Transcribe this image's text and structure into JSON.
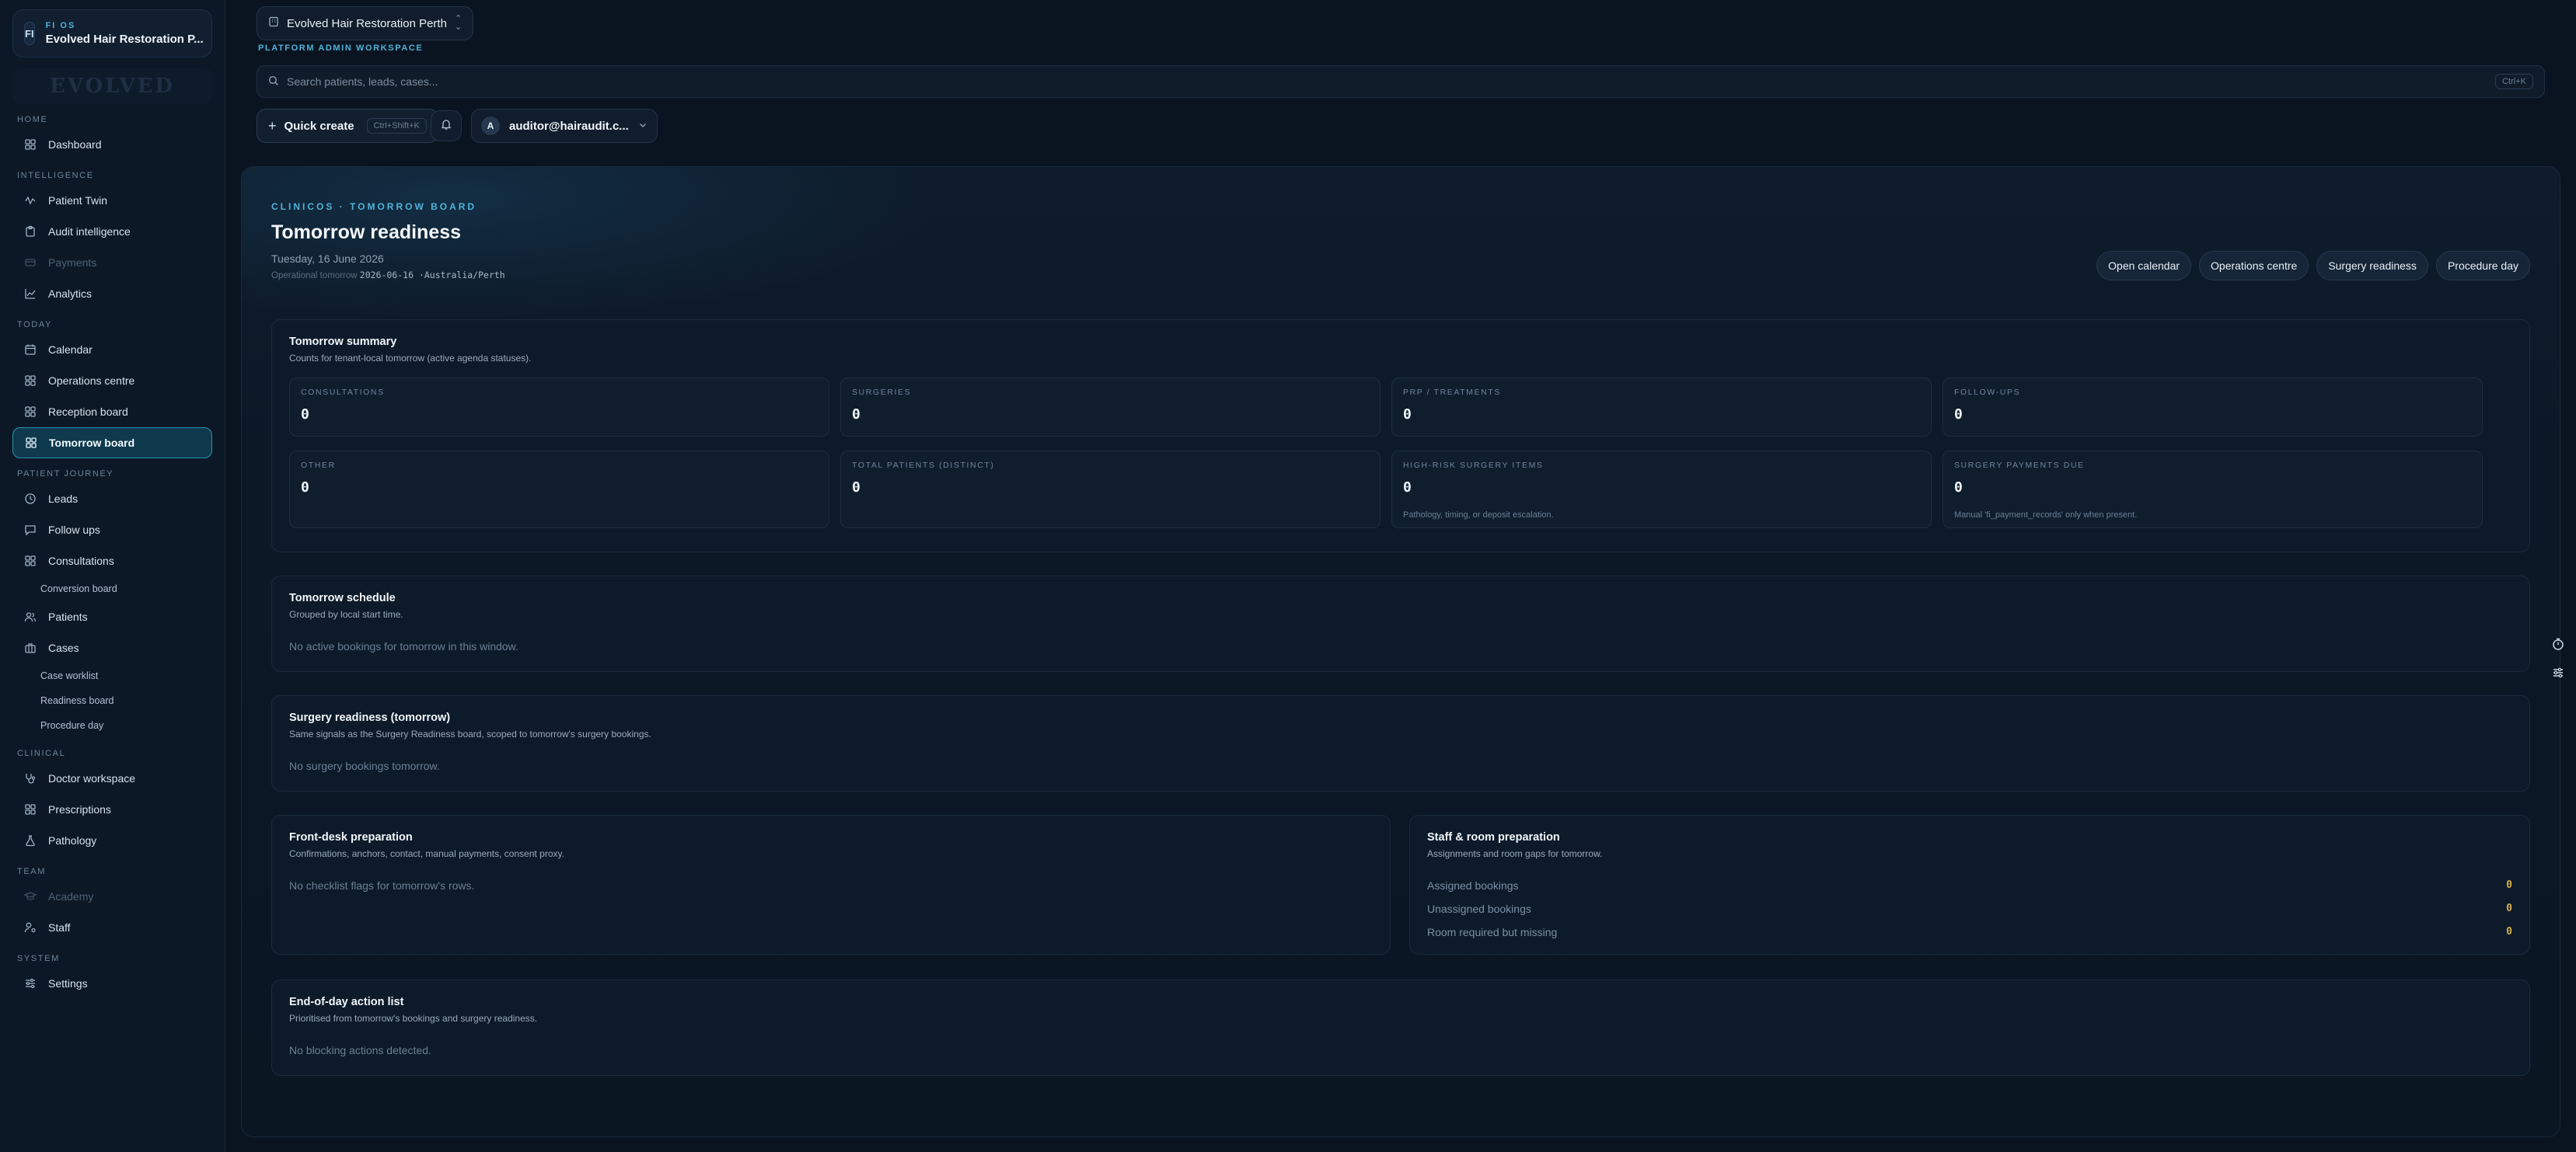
{
  "brand": {
    "os": "FI OS",
    "badge": "FI",
    "name": "Evolved Hair Restoration P...",
    "logo": "EVOLVED"
  },
  "sidebar": {
    "sections": [
      {
        "label": "HOME",
        "items": [
          {
            "label": "Dashboard",
            "icon": "grid-icon"
          }
        ]
      },
      {
        "label": "INTELLIGENCE",
        "items": [
          {
            "label": "Patient Twin",
            "icon": "twin-icon"
          },
          {
            "label": "Audit intelligence",
            "icon": "clipboard-icon"
          },
          {
            "label": "Payments",
            "icon": "card-icon",
            "dim": true
          },
          {
            "label": "Analytics",
            "icon": "chart-icon"
          }
        ]
      },
      {
        "label": "TODAY",
        "items": [
          {
            "label": "Calendar",
            "icon": "calendar-icon"
          },
          {
            "label": "Operations centre",
            "icon": "grid-icon"
          },
          {
            "label": "Reception board",
            "icon": "grid-icon"
          },
          {
            "label": "Tomorrow board",
            "icon": "grid-icon",
            "active": true
          }
        ]
      },
      {
        "label": "PATIENT JOURNEY",
        "items": [
          {
            "label": "Leads",
            "icon": "clock-icon"
          },
          {
            "label": "Follow ups",
            "icon": "message-icon"
          },
          {
            "label": "Consultations",
            "icon": "grid-icon"
          },
          {
            "label": "Conversion board",
            "sub": true
          },
          {
            "label": "Patients",
            "icon": "users-icon"
          },
          {
            "label": "Cases",
            "icon": "briefcase-icon"
          },
          {
            "label": "Case worklist",
            "sub": true
          },
          {
            "label": "Readiness board",
            "sub": true
          },
          {
            "label": "Procedure day",
            "sub": true
          }
        ]
      },
      {
        "label": "CLINICAL",
        "items": [
          {
            "label": "Doctor workspace",
            "icon": "stethoscope-icon"
          },
          {
            "label": "Prescriptions",
            "icon": "grid-icon"
          },
          {
            "label": "Pathology",
            "icon": "flask-icon"
          }
        ]
      },
      {
        "label": "TEAM",
        "items": [
          {
            "label": "Academy",
            "icon": "cap-icon",
            "dim": true
          },
          {
            "label": "Staff",
            "icon": "user-cog-icon"
          }
        ]
      },
      {
        "label": "SYSTEM",
        "items": [
          {
            "label": "Settings",
            "icon": "sliders-icon"
          }
        ]
      }
    ]
  },
  "topbar": {
    "workspace": "Evolved Hair Restoration Perth",
    "workspace_label": "PLATFORM ADMIN WORKSPACE",
    "search_placeholder": "Search patients, leads, cases...",
    "search_shortcut": "Ctrl+K",
    "quick_create": "Quick create",
    "quick_create_shortcut": "Ctrl+Shift+K",
    "user_initial": "A",
    "user": "auditor@hairaudit.c..."
  },
  "page": {
    "eyebrow": "CLINICOS · TOMORROW BOARD",
    "title": "Tomorrow readiness",
    "date": "Tuesday, 16 June 2026",
    "optom_label": "Operational tomorrow",
    "optom_value": "2026-06-16 ·Australia/Perth",
    "actions": [
      "Open calendar",
      "Operations centre",
      "Surgery readiness",
      "Procedure day"
    ]
  },
  "summary": {
    "title": "Tomorrow summary",
    "subtitle": "Counts for tenant-local tomorrow (active agenda statuses).",
    "stats": [
      {
        "label": "CONSULTATIONS",
        "value": "0"
      },
      {
        "label": "SURGERIES",
        "value": "0"
      },
      {
        "label": "PRP / TREATMENTS",
        "value": "0"
      },
      {
        "label": "FOLLOW-UPS",
        "value": "0"
      },
      {
        "label": "OTHER",
        "value": "0"
      },
      {
        "label": "TOTAL PATIENTS (DISTINCT)",
        "value": "0"
      },
      {
        "label": "HIGH-RISK SURGERY ITEMS",
        "value": "0",
        "note": "Pathology, timing, or deposit escalation."
      },
      {
        "label": "SURGERY PAYMENTS DUE",
        "value": "0",
        "note": "Manual 'fi_payment_records' only when present."
      }
    ]
  },
  "schedule": {
    "title": "Tomorrow schedule",
    "subtitle": "Grouped by local start time.",
    "empty": "No active bookings for tomorrow in this window."
  },
  "surgery": {
    "title": "Surgery readiness (tomorrow)",
    "subtitle": "Same signals as the Surgery Readiness board, scoped to tomorrow's surgery bookings.",
    "empty": "No surgery bookings tomorrow."
  },
  "frontdesk": {
    "title": "Front-desk preparation",
    "subtitle": "Confirmations, anchors, contact, manual payments, consent proxy.",
    "empty": "No checklist flags for tomorrow's rows."
  },
  "staff": {
    "title": "Staff & room preparation",
    "subtitle": "Assignments and room gaps for tomorrow.",
    "rows": [
      {
        "label": "Assigned bookings",
        "value": "0"
      },
      {
        "label": "Unassigned bookings",
        "value": "0"
      },
      {
        "label": "Room required but missing",
        "value": "0"
      }
    ]
  },
  "eod": {
    "title": "End-of-day action list",
    "subtitle": "Prioritised from tomorrow's bookings and surgery readiness.",
    "empty": "No blocking actions detected."
  },
  "colors": {
    "accent": "#4fb3d9",
    "active_bg": "#0f3a4d",
    "warn_value": "#d6b14a"
  }
}
